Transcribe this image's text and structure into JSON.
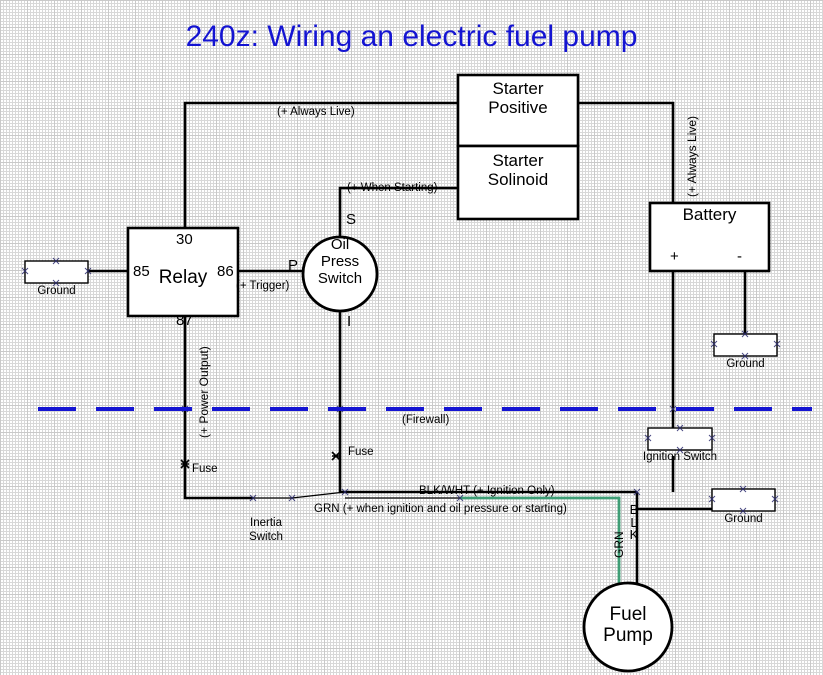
{
  "title": "240z: Wiring an electric fuel pump",
  "colors": {
    "title": "#1414d2",
    "firewall": "#1414d2",
    "wire_black": "#000000",
    "wire_green": "#3f9e76",
    "grid": "#d8d8d8",
    "background": "#ffffff"
  },
  "components": {
    "relay": {
      "label": "Relay",
      "terminal_30": "30",
      "terminal_85": "85",
      "terminal_86": "86",
      "terminal_87": "87"
    },
    "oil_press_switch": {
      "line1": "Oil",
      "line2": "Press",
      "line3": "Switch",
      "terminal_s": "S",
      "terminal_p": "P",
      "terminal_i": "I"
    },
    "starter_positive": {
      "line1": "Starter",
      "line2": "Positive"
    },
    "starter_solenoid": {
      "line1": "Starter",
      "line2": "Solinoid"
    },
    "battery": {
      "label": "Battery",
      "positive": "+",
      "negative": "-"
    },
    "ignition_switch": {
      "label": "Ignition Switch"
    },
    "inertia_switch": {
      "line1": "Inertia",
      "line2": "Switch"
    },
    "fuel_pump": {
      "line1": "Fuel",
      "line2": "Pump"
    },
    "ground_left": {
      "label": "Ground"
    },
    "ground_battery": {
      "label": "Ground"
    },
    "ground_pump": {
      "label": "Ground"
    }
  },
  "wire_labels": {
    "always_live_top": "(+ Always Live)",
    "always_live_right": "(+ Always Live)",
    "when_starting": "(+ When Starting)",
    "trigger": "(+ Trigger)",
    "power_output": "(+ Power Output)",
    "firewall": "(Firewall)",
    "fuse_left": "Fuse",
    "fuse_mid": "Fuse",
    "blk_wht": "BLK/WHT (+ Ignition Only)",
    "grn": "GRN (+ when ignition and oil pressure or starting)",
    "grn_vertical": "GRN",
    "blk_vertical_b": "B",
    "blk_vertical_l": "L",
    "blk_vertical_k": "K"
  }
}
